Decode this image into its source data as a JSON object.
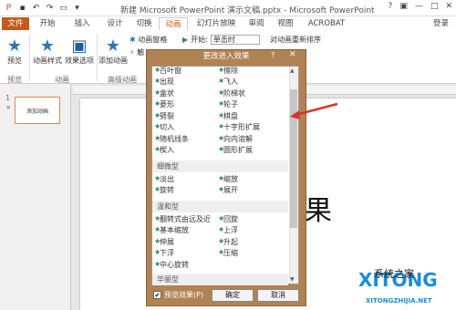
{
  "window": {
    "title": "新建 Microsoft PowerPoint 演示文稿.pptx - Microsoft PowerPoint",
    "controls": [
      "?",
      "▣",
      "—",
      "□",
      "✕"
    ],
    "login": "登录"
  },
  "tabs": [
    "文件",
    "开始",
    "插入",
    "设计",
    "切换",
    "动画",
    "幻灯片放映",
    "审阅",
    "视图",
    "ACROBAT"
  ],
  "active_tab_index": 5,
  "ribbon": {
    "preview_label": "预览",
    "anim_style_label": "动画样式",
    "effect_options_label": "效果选项",
    "add_anim_label": "添加动画",
    "anim_pane_label": "动画窗格",
    "trigger_label": "触",
    "start_label": "开始:",
    "start_value": "单击时",
    "reorder_label": "对动画重新排序",
    "group_preview": "预览",
    "group_anim": "动画",
    "group_adv": "高级动画"
  },
  "slide_panel": {
    "number": "1",
    "star": "★",
    "thumb_text": "添加动画"
  },
  "slide": {
    "visible_char": "果"
  },
  "dialog": {
    "title": "更改进入效果",
    "help": "?",
    "close": "✕",
    "top_partial": [
      "百叶窗",
      "擦除"
    ],
    "basic": [
      [
        "出现",
        "飞入"
      ],
      [
        "盒状",
        "阶梯状"
      ],
      [
        "菱形",
        "轮子"
      ],
      [
        "劈裂",
        "棋盘"
      ],
      [
        "切入",
        "十字形扩展"
      ],
      [
        "随机线条",
        "向内溶解"
      ],
      [
        "楔入",
        "圆形扩展"
      ]
    ],
    "section_subtle": "细微型",
    "subtle": [
      [
        "淡出",
        "缩放"
      ],
      [
        "旋转",
        "展开"
      ]
    ],
    "section_moderate": "温和型",
    "moderate": [
      [
        "翻转式由远及近",
        "回旋"
      ],
      [
        "基本缩放",
        "上浮"
      ],
      [
        "伸展",
        "升起"
      ],
      [
        "下浮",
        "压缩"
      ],
      [
        "中心旋转",
        ""
      ]
    ],
    "section_exciting": "华丽型",
    "preview_effect": "预览效果(P)",
    "preview_checked": "✔",
    "ok": "确定",
    "cancel": "取消"
  },
  "watermark": {
    "logo": "系统之家",
    "logo_mark": "XITONG",
    "url": "XITONGZHIJIA.NET",
    "accent": "#1a8dd8"
  },
  "colors": {
    "accent": "#c55a1a",
    "dialog": "#b18253",
    "star": "#2e8b57",
    "arrow": "#d9342b"
  }
}
